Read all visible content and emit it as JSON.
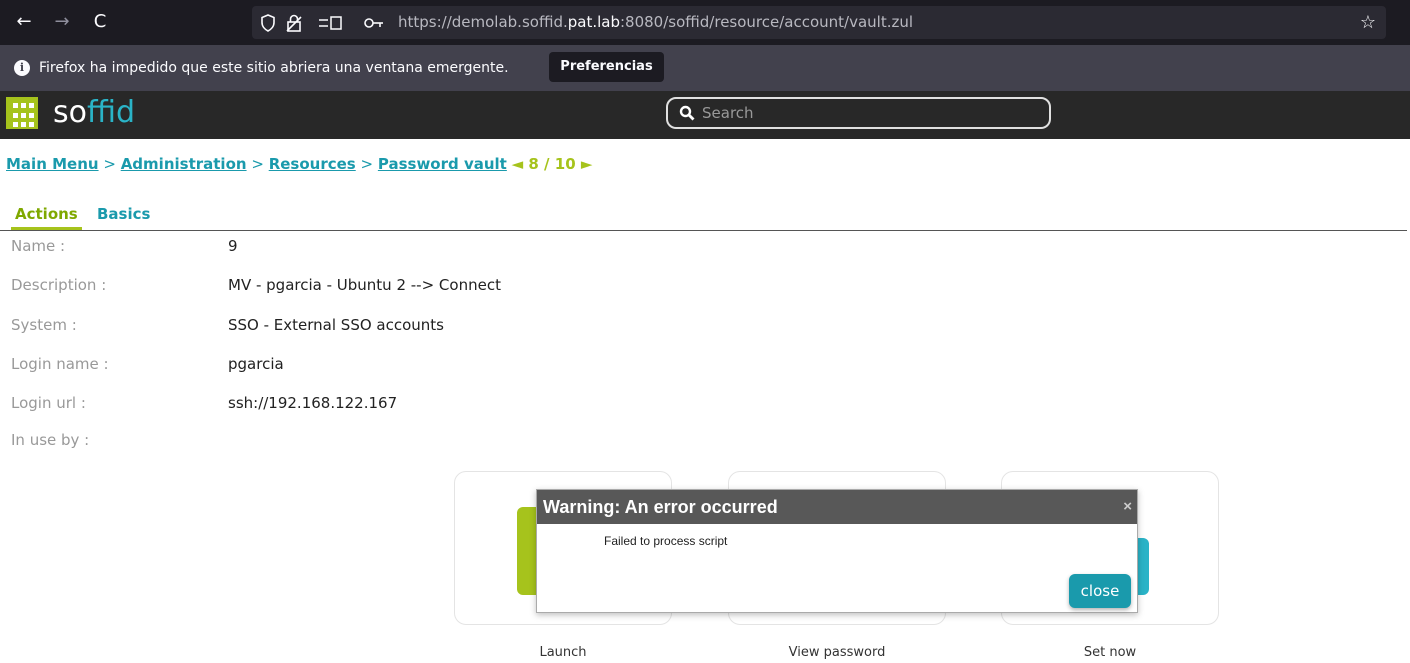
{
  "browser": {
    "back_icon": "←",
    "forward_icon": "→",
    "reload_icon": "C",
    "url_prefix": "https://demolab.soffid.",
    "url_host": "pat.lab",
    "url_suffix": ":8080/soffid/resource/account/vault.zul",
    "star_icon": "☆"
  },
  "notification": {
    "icon": "i",
    "text": "Firefox ha impedido que este sitio abriera una ventana emergente.",
    "button": "Preferencias"
  },
  "header": {
    "logo_so": "so",
    "logo_fid": "ffid",
    "search_placeholder": "Search"
  },
  "breadcrumb": {
    "items": [
      "Main Menu",
      "Administration",
      "Resources",
      "Password vault"
    ],
    "separator": ">",
    "pager": "◄ 8 / 10 ►"
  },
  "tabs": [
    {
      "label": "Actions",
      "active": true
    },
    {
      "label": "Basics",
      "active": false
    }
  ],
  "fields": [
    {
      "label": "Name :",
      "value": "9"
    },
    {
      "label": "Description :",
      "value": "MV - pgarcia - Ubuntu 2 --> Connect"
    },
    {
      "label": "System :",
      "value": " SSO - External SSO accounts"
    },
    {
      "label": "Login name :",
      "value": "pgarcia"
    },
    {
      "label": "Login url :",
      "value": "ssh://192.168.122.167"
    },
    {
      "label": "In use by :",
      "value": ""
    }
  ],
  "actions": [
    {
      "label": "Launch"
    },
    {
      "label": "View password"
    },
    {
      "label": "Set now"
    }
  ],
  "dialog": {
    "title": "Warning: An error occurred",
    "close_x": "×",
    "message": "Failed to process script",
    "button": "close"
  },
  "colors": {
    "accent_green": "#a6c31c",
    "accent_teal": "#1a9aac",
    "header_bg": "#282828"
  }
}
